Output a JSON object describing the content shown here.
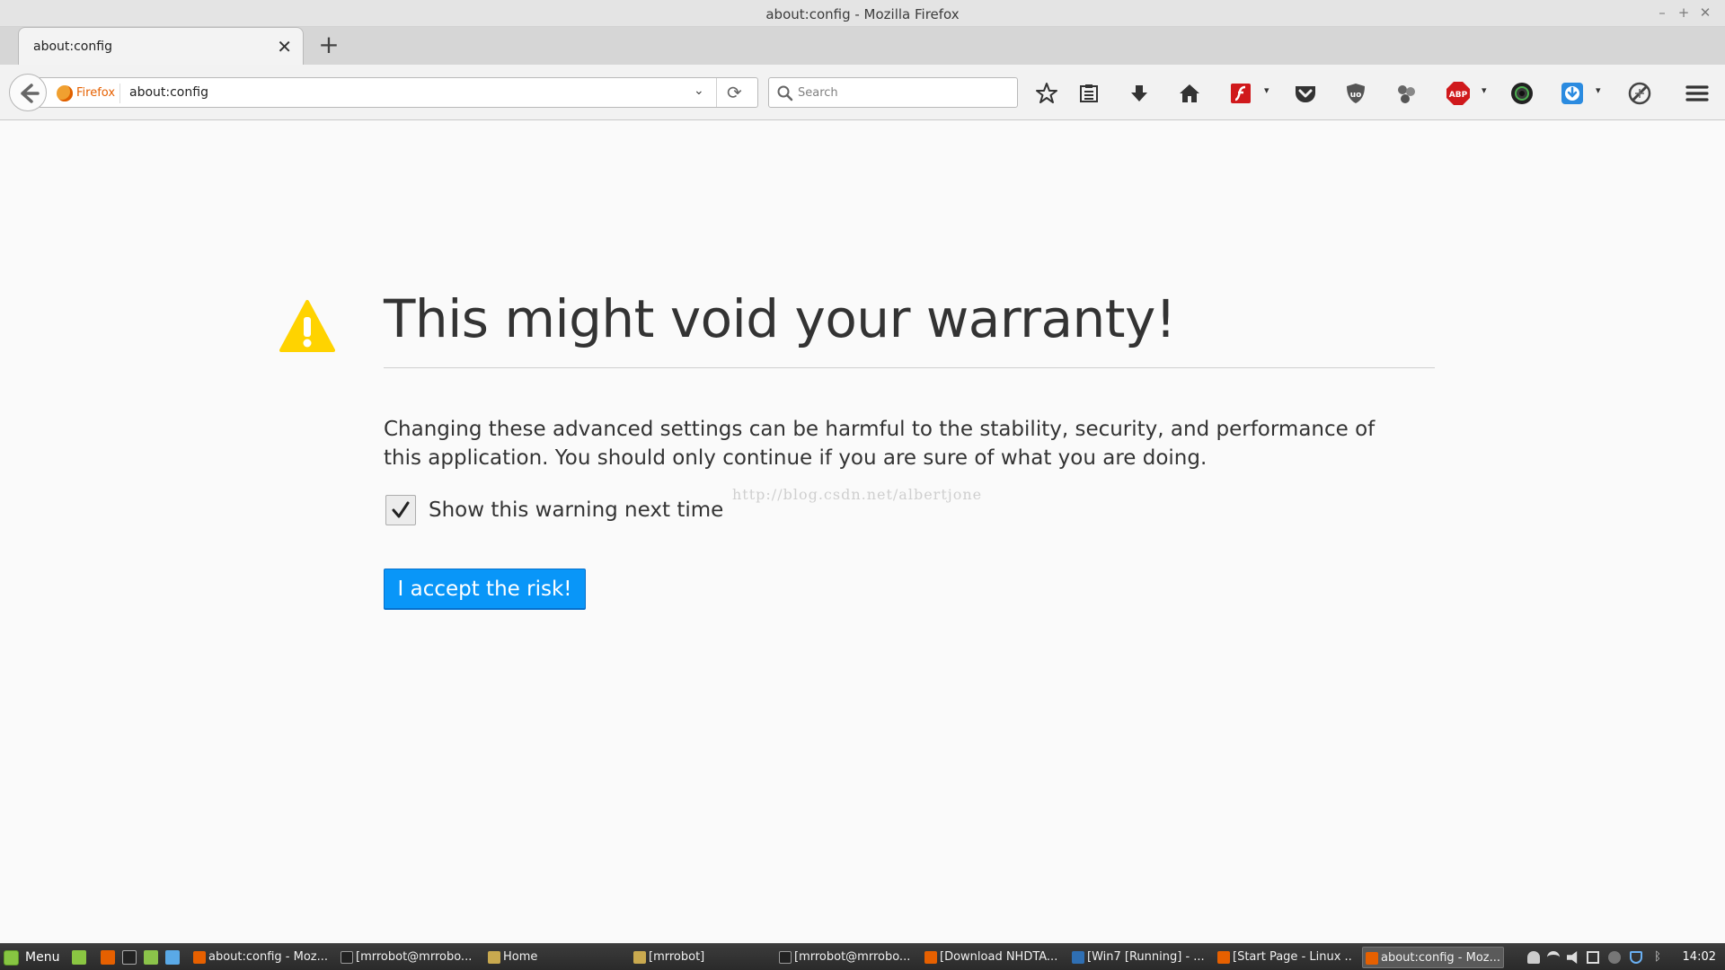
{
  "window": {
    "title": "about:config - Mozilla Firefox"
  },
  "tab": {
    "label": "about:config"
  },
  "navbar": {
    "identity_label": "Firefox",
    "url": "about:config",
    "search_placeholder": "Search"
  },
  "content": {
    "heading": "This might void your warranty!",
    "description": "Changing these advanced settings can be harmful to the stability, security, and performance of this application. You should only continue if you are sure of what you are doing.",
    "checkbox_label": "Show this warning next time",
    "checkbox_checked": true,
    "watermark": "http://blog.csdn.net/albertjone",
    "accept_button": "I accept the risk!"
  },
  "toolbar_icons": [
    "star-icon",
    "reading-list-icon",
    "download-icon",
    "home-icon",
    "flash-icon",
    "pocket-icon",
    "ublock-icon",
    "extension-icon",
    "adblock-plus-icon",
    "camera-icon",
    "download-manager-icon",
    "no-script-icon",
    "hamburger-menu-icon"
  ],
  "taskbar": {
    "menu_label": "Menu",
    "tasks": [
      "about:config - Moz...",
      "[mrrobot@mrrobo...",
      "Home",
      "[mrrobot]",
      "[mrrobot@mrrobo...",
      "[Download NHDTA...",
      "[Win7 [Running] - ...",
      "[Start Page - Linux ...",
      "about:config - Moz..."
    ],
    "clock": "14:02"
  },
  "colors": {
    "accent": "#0996f8",
    "warning": "#ffd300",
    "page_bg": "#fafafa"
  }
}
